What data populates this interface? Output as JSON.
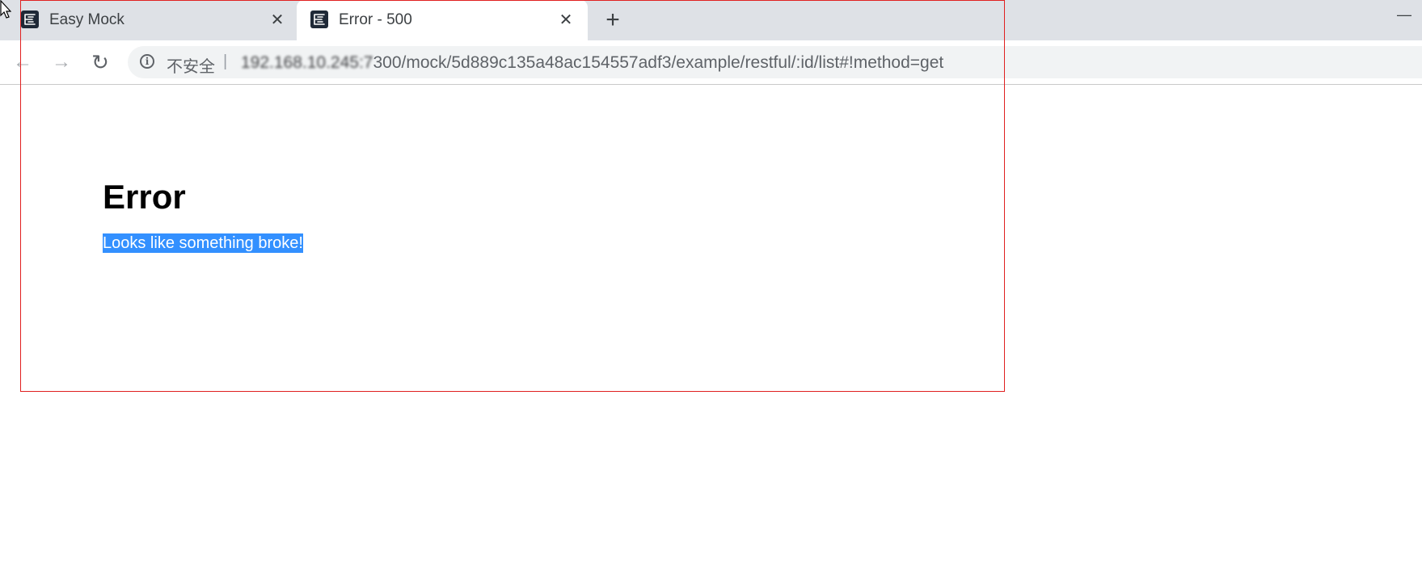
{
  "browser": {
    "tabs": [
      {
        "title": "Easy Mock",
        "active": false,
        "close_glyph": "✕"
      },
      {
        "title": "Error - 500",
        "active": true,
        "close_glyph": "✕"
      }
    ],
    "new_tab_glyph": "+",
    "minimize_glyph": "—",
    "toolbar": {
      "back_glyph": "←",
      "forward_glyph": "→",
      "reload_glyph": "↻"
    },
    "omnibox": {
      "info_glyph": "i",
      "security_label": "不安全",
      "separator": "|",
      "url_host_redacted": "192.168.10.245:7",
      "url_path": "300/mock/5d889c135a48ac154557adf3/example/restful/:id/list#!method=get"
    }
  },
  "page": {
    "title": "Error",
    "message": "Looks like something broke!"
  },
  "colors": {
    "tabstrip": "#dee1e6",
    "selection": "#3390ff",
    "annotation_border": "#e02020"
  },
  "icons": {
    "favicon": "easy-mock-favicon",
    "info": "info-icon"
  }
}
